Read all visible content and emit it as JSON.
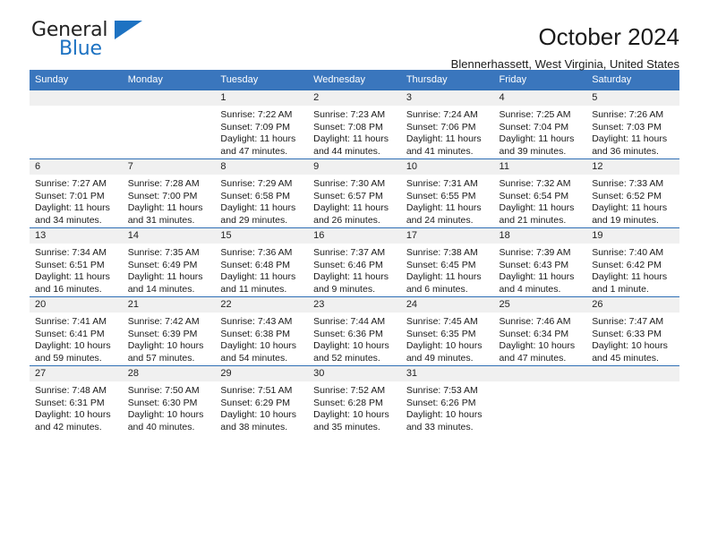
{
  "logo": {
    "word1": "General",
    "word2": "Blue",
    "triangle": "blue-triangle-icon",
    "color": "#1d72c2"
  },
  "header": {
    "title": "October 2024",
    "subtitle": "Blennerhassett, West Virginia, United States"
  },
  "theme": {
    "header_blue": "#3a76bd",
    "row_divider_blue": "#2f6fb5",
    "daynum_band": "#f0f0f0"
  },
  "calendar": {
    "weekday_headers": [
      "Sunday",
      "Monday",
      "Tuesday",
      "Wednesday",
      "Thursday",
      "Friday",
      "Saturday"
    ],
    "weeks": [
      [
        {
          "day": "",
          "sunrise": "",
          "sunset": "",
          "daylight": ""
        },
        {
          "day": "",
          "sunrise": "",
          "sunset": "",
          "daylight": ""
        },
        {
          "day": "1",
          "sunrise": "Sunrise: 7:22 AM",
          "sunset": "Sunset: 7:09 PM",
          "daylight": "Daylight: 11 hours and 47 minutes."
        },
        {
          "day": "2",
          "sunrise": "Sunrise: 7:23 AM",
          "sunset": "Sunset: 7:08 PM",
          "daylight": "Daylight: 11 hours and 44 minutes."
        },
        {
          "day": "3",
          "sunrise": "Sunrise: 7:24 AM",
          "sunset": "Sunset: 7:06 PM",
          "daylight": "Daylight: 11 hours and 41 minutes."
        },
        {
          "day": "4",
          "sunrise": "Sunrise: 7:25 AM",
          "sunset": "Sunset: 7:04 PM",
          "daylight": "Daylight: 11 hours and 39 minutes."
        },
        {
          "day": "5",
          "sunrise": "Sunrise: 7:26 AM",
          "sunset": "Sunset: 7:03 PM",
          "daylight": "Daylight: 11 hours and 36 minutes."
        }
      ],
      [
        {
          "day": "6",
          "sunrise": "Sunrise: 7:27 AM",
          "sunset": "Sunset: 7:01 PM",
          "daylight": "Daylight: 11 hours and 34 minutes."
        },
        {
          "day": "7",
          "sunrise": "Sunrise: 7:28 AM",
          "sunset": "Sunset: 7:00 PM",
          "daylight": "Daylight: 11 hours and 31 minutes."
        },
        {
          "day": "8",
          "sunrise": "Sunrise: 7:29 AM",
          "sunset": "Sunset: 6:58 PM",
          "daylight": "Daylight: 11 hours and 29 minutes."
        },
        {
          "day": "9",
          "sunrise": "Sunrise: 7:30 AM",
          "sunset": "Sunset: 6:57 PM",
          "daylight": "Daylight: 11 hours and 26 minutes."
        },
        {
          "day": "10",
          "sunrise": "Sunrise: 7:31 AM",
          "sunset": "Sunset: 6:55 PM",
          "daylight": "Daylight: 11 hours and 24 minutes."
        },
        {
          "day": "11",
          "sunrise": "Sunrise: 7:32 AM",
          "sunset": "Sunset: 6:54 PM",
          "daylight": "Daylight: 11 hours and 21 minutes."
        },
        {
          "day": "12",
          "sunrise": "Sunrise: 7:33 AM",
          "sunset": "Sunset: 6:52 PM",
          "daylight": "Daylight: 11 hours and 19 minutes."
        }
      ],
      [
        {
          "day": "13",
          "sunrise": "Sunrise: 7:34 AM",
          "sunset": "Sunset: 6:51 PM",
          "daylight": "Daylight: 11 hours and 16 minutes."
        },
        {
          "day": "14",
          "sunrise": "Sunrise: 7:35 AM",
          "sunset": "Sunset: 6:49 PM",
          "daylight": "Daylight: 11 hours and 14 minutes."
        },
        {
          "day": "15",
          "sunrise": "Sunrise: 7:36 AM",
          "sunset": "Sunset: 6:48 PM",
          "daylight": "Daylight: 11 hours and 11 minutes."
        },
        {
          "day": "16",
          "sunrise": "Sunrise: 7:37 AM",
          "sunset": "Sunset: 6:46 PM",
          "daylight": "Daylight: 11 hours and 9 minutes."
        },
        {
          "day": "17",
          "sunrise": "Sunrise: 7:38 AM",
          "sunset": "Sunset: 6:45 PM",
          "daylight": "Daylight: 11 hours and 6 minutes."
        },
        {
          "day": "18",
          "sunrise": "Sunrise: 7:39 AM",
          "sunset": "Sunset: 6:43 PM",
          "daylight": "Daylight: 11 hours and 4 minutes."
        },
        {
          "day": "19",
          "sunrise": "Sunrise: 7:40 AM",
          "sunset": "Sunset: 6:42 PM",
          "daylight": "Daylight: 11 hours and 1 minute."
        }
      ],
      [
        {
          "day": "20",
          "sunrise": "Sunrise: 7:41 AM",
          "sunset": "Sunset: 6:41 PM",
          "daylight": "Daylight: 10 hours and 59 minutes."
        },
        {
          "day": "21",
          "sunrise": "Sunrise: 7:42 AM",
          "sunset": "Sunset: 6:39 PM",
          "daylight": "Daylight: 10 hours and 57 minutes."
        },
        {
          "day": "22",
          "sunrise": "Sunrise: 7:43 AM",
          "sunset": "Sunset: 6:38 PM",
          "daylight": "Daylight: 10 hours and 54 minutes."
        },
        {
          "day": "23",
          "sunrise": "Sunrise: 7:44 AM",
          "sunset": "Sunset: 6:36 PM",
          "daylight": "Daylight: 10 hours and 52 minutes."
        },
        {
          "day": "24",
          "sunrise": "Sunrise: 7:45 AM",
          "sunset": "Sunset: 6:35 PM",
          "daylight": "Daylight: 10 hours and 49 minutes."
        },
        {
          "day": "25",
          "sunrise": "Sunrise: 7:46 AM",
          "sunset": "Sunset: 6:34 PM",
          "daylight": "Daylight: 10 hours and 47 minutes."
        },
        {
          "day": "26",
          "sunrise": "Sunrise: 7:47 AM",
          "sunset": "Sunset: 6:33 PM",
          "daylight": "Daylight: 10 hours and 45 minutes."
        }
      ],
      [
        {
          "day": "27",
          "sunrise": "Sunrise: 7:48 AM",
          "sunset": "Sunset: 6:31 PM",
          "daylight": "Daylight: 10 hours and 42 minutes."
        },
        {
          "day": "28",
          "sunrise": "Sunrise: 7:50 AM",
          "sunset": "Sunset: 6:30 PM",
          "daylight": "Daylight: 10 hours and 40 minutes."
        },
        {
          "day": "29",
          "sunrise": "Sunrise: 7:51 AM",
          "sunset": "Sunset: 6:29 PM",
          "daylight": "Daylight: 10 hours and 38 minutes."
        },
        {
          "day": "30",
          "sunrise": "Sunrise: 7:52 AM",
          "sunset": "Sunset: 6:28 PM",
          "daylight": "Daylight: 10 hours and 35 minutes."
        },
        {
          "day": "31",
          "sunrise": "Sunrise: 7:53 AM",
          "sunset": "Sunset: 6:26 PM",
          "daylight": "Daylight: 10 hours and 33 minutes."
        },
        {
          "day": "",
          "sunrise": "",
          "sunset": "",
          "daylight": ""
        },
        {
          "day": "",
          "sunrise": "",
          "sunset": "",
          "daylight": ""
        }
      ]
    ]
  }
}
